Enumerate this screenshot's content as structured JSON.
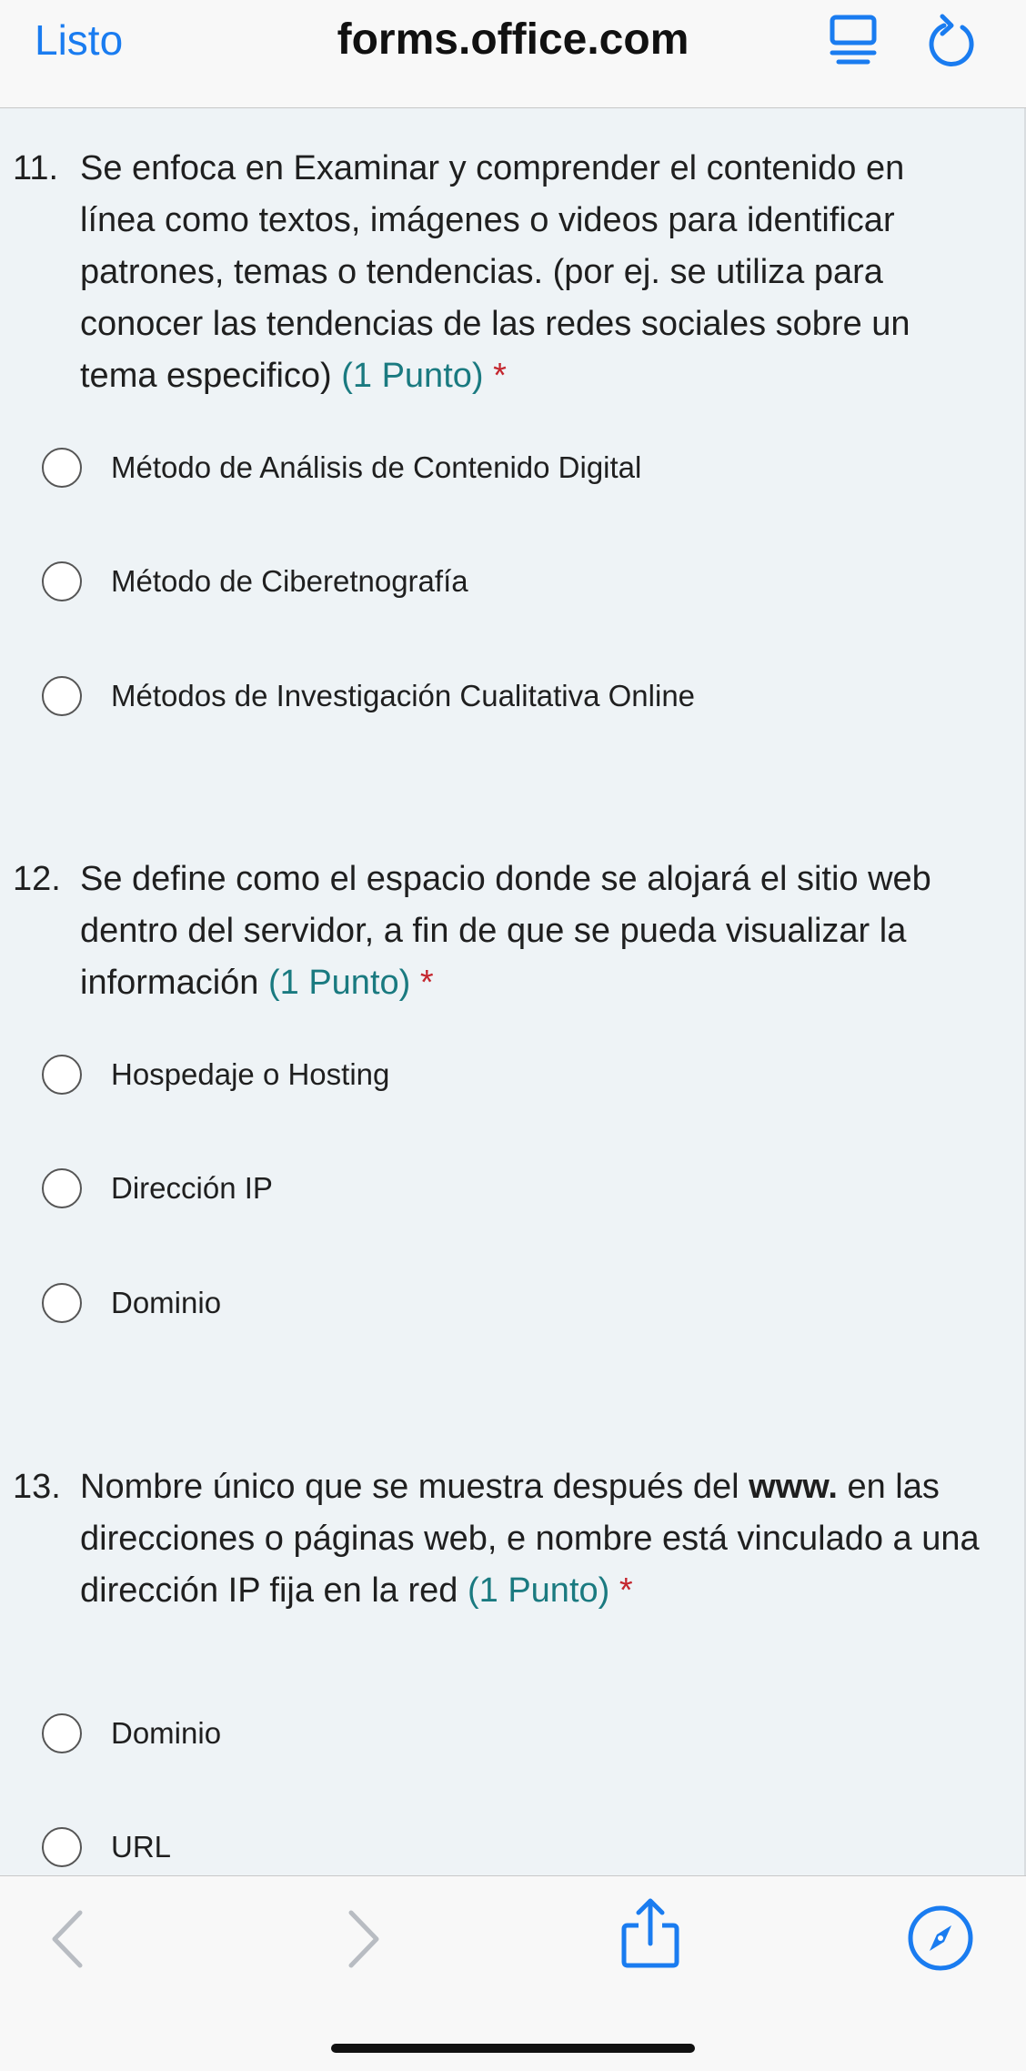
{
  "browser": {
    "done_label": "Listo",
    "url": "forms.office.com",
    "icons": {
      "reader": "reader-mode-icon",
      "reload": "reload-icon",
      "back": "chevron-left-icon",
      "forward": "chevron-right-icon",
      "share": "share-icon",
      "safari": "compass-icon"
    },
    "accent_color": "#1a7cf0"
  },
  "form": {
    "points_color": "#1a7a80",
    "required_color": "#c4262e",
    "questions": [
      {
        "number": "11.",
        "text": "Se enfoca en Examinar y comprender el contenido en línea como textos, imágenes o videos para identificar patrones, temas o tendencias. (por ej. se utiliza para conocer las tendencias de las redes sociales sobre un tema especifico) ",
        "points": "(1 Punto)",
        "required": "*",
        "options": [
          "Método de Análisis de Contenido Digital",
          "Método de Ciberetnografía",
          "Métodos de Investigación Cualitativa Online"
        ]
      },
      {
        "number": "12.",
        "text": "Se define como el espacio donde se alojará el sitio web dentro del servidor, a fin de que se pueda visualizar la información ",
        "points": "(1 Punto)",
        "required": "*",
        "options": [
          "Hospedaje o Hosting",
          "Dirección IP",
          "Dominio"
        ]
      },
      {
        "number": "13.",
        "text_before_bold": "Nombre único que se muestra después del ",
        "text_bold": "www.",
        "text_after_bold": " en las direcciones o páginas web, e nombre está vinculado a una dirección IP fija en la red ",
        "points": "(1 Punto)",
        "required": "*",
        "options": [
          "Dominio",
          "URL"
        ]
      }
    ]
  }
}
